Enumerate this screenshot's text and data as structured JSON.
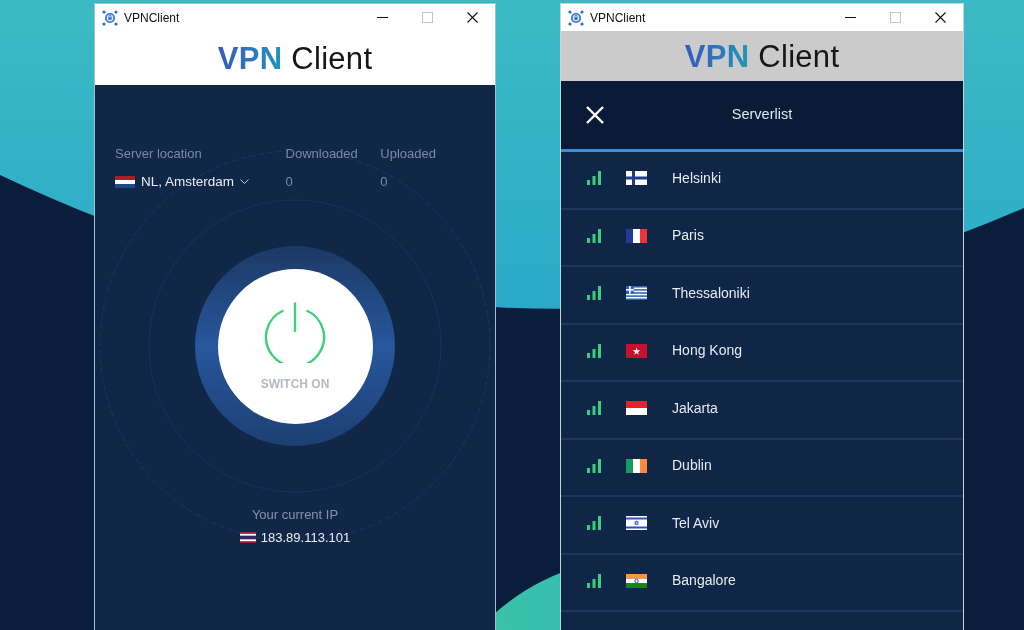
{
  "main_window": {
    "title": "VPNClient",
    "controls": [
      {
        "kind": "minimize",
        "disabled": false
      },
      {
        "kind": "maximize",
        "disabled": true
      },
      {
        "kind": "close",
        "disabled": false
      }
    ],
    "logo": "**VPN** Client",
    "server_location": {
      "label": "Server location",
      "value": "NL, Amsterdam",
      "kind": "nl"
    },
    "stats": [
      {
        "label": "Downloaded",
        "value": "0"
      },
      {
        "label": "Uploaded",
        "value": "0"
      }
    ],
    "power_button": {
      "label": "SWITCH ON"
    },
    "current_ip": {
      "label": "Your current IP",
      "value": "183.89.113.101",
      "kind": "th"
    }
  },
  "serverlist_window": {
    "title": "VPNClient",
    "controls": [
      {
        "kind": "minimize",
        "disabled": false
      },
      {
        "kind": "maximize",
        "disabled": true
      },
      {
        "kind": "close",
        "disabled": false
      }
    ],
    "logo": "**VPN** Client",
    "header": {
      "title": "Serverlist"
    },
    "servers": [
      {
        "name": "Helsinki",
        "kind": "fi"
      },
      {
        "name": "Paris",
        "kind": "fr"
      },
      {
        "name": "Thessaloniki",
        "kind": "gr"
      },
      {
        "name": "Hong Kong",
        "kind": "hk"
      },
      {
        "name": "Jakarta",
        "kind": "id"
      },
      {
        "name": "Dublin",
        "kind": "ie"
      },
      {
        "name": "Tel Aviv",
        "kind": "il"
      },
      {
        "name": "Bangalore",
        "kind": "in"
      }
    ]
  }
}
